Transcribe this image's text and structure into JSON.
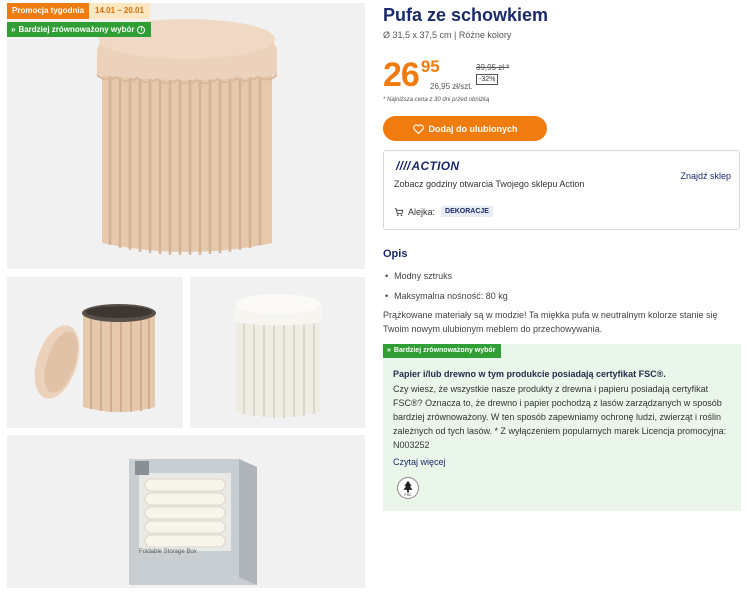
{
  "badges": {
    "promo_label": "Promocja tygodnia",
    "promo_dates": "14.01 – 20.01",
    "eco_label": "Bardziej zrównoważony wybór",
    "eco_info": "i"
  },
  "product": {
    "title": "Pufa ze schowkiem",
    "subtitle": "Ø 31,5 x 37,5 cm | Różne kolory",
    "price_int": "26",
    "price_dec": "95",
    "unit_price": "26,95 zł/szt.",
    "old_price": "39,95 zł *",
    "discount": "-32%",
    "lowest_note": "* Najniższa cena z 30 dni przed obniżką"
  },
  "favorite_button": {
    "label": "Dodaj do ulubionych"
  },
  "store": {
    "logo": "ACTION",
    "link": "Znajdź sklep",
    "hours": "Zobacz godziny otwarcia Twojego sklepu Action",
    "aisle_label": "Alejka:",
    "aisle_tag": "DEKORACJE"
  },
  "description": {
    "heading": "Opis",
    "bullets": [
      "Modny sztruks",
      "Maksymalna nośność: 80 kg"
    ],
    "text": "Prążkowane materiały są w modzie! Ta miękka pufa w neutralnym kolorze stanie się Twoim nowym ulubionym meblem do przechowywania."
  },
  "eco_panel": {
    "badge": "Bardziej zrównoważony wybór",
    "title": "Papier i/lub drewno w tym produkcie posiadają certyfikat FSC®.",
    "text": "Czy wiesz, że wszystkie nasze produkty z drewna i papieru posiadają certyfikat FSC®? Oznacza to, że drewno i papier pochodzą z lasów zarządzanych w sposób bardziej zrównoważony. W ten sposób zapewniamy ochronę ludzi, zwierząt i roślin zależnych od tych lasów. * Z wyłączeniem popularnych marek Licencja promocyjna: N003252",
    "read_more": "Czytaj więcej",
    "fsc_text": "FSC"
  },
  "packaging": {
    "box_text": "Foldable Storage Box"
  },
  "colors": {
    "orange": "#f07c10",
    "green": "#2f9e34",
    "navy": "#1b2a6b",
    "beige_pouf": "#e9cdb5",
    "white_pouf": "#f4f1ea"
  }
}
